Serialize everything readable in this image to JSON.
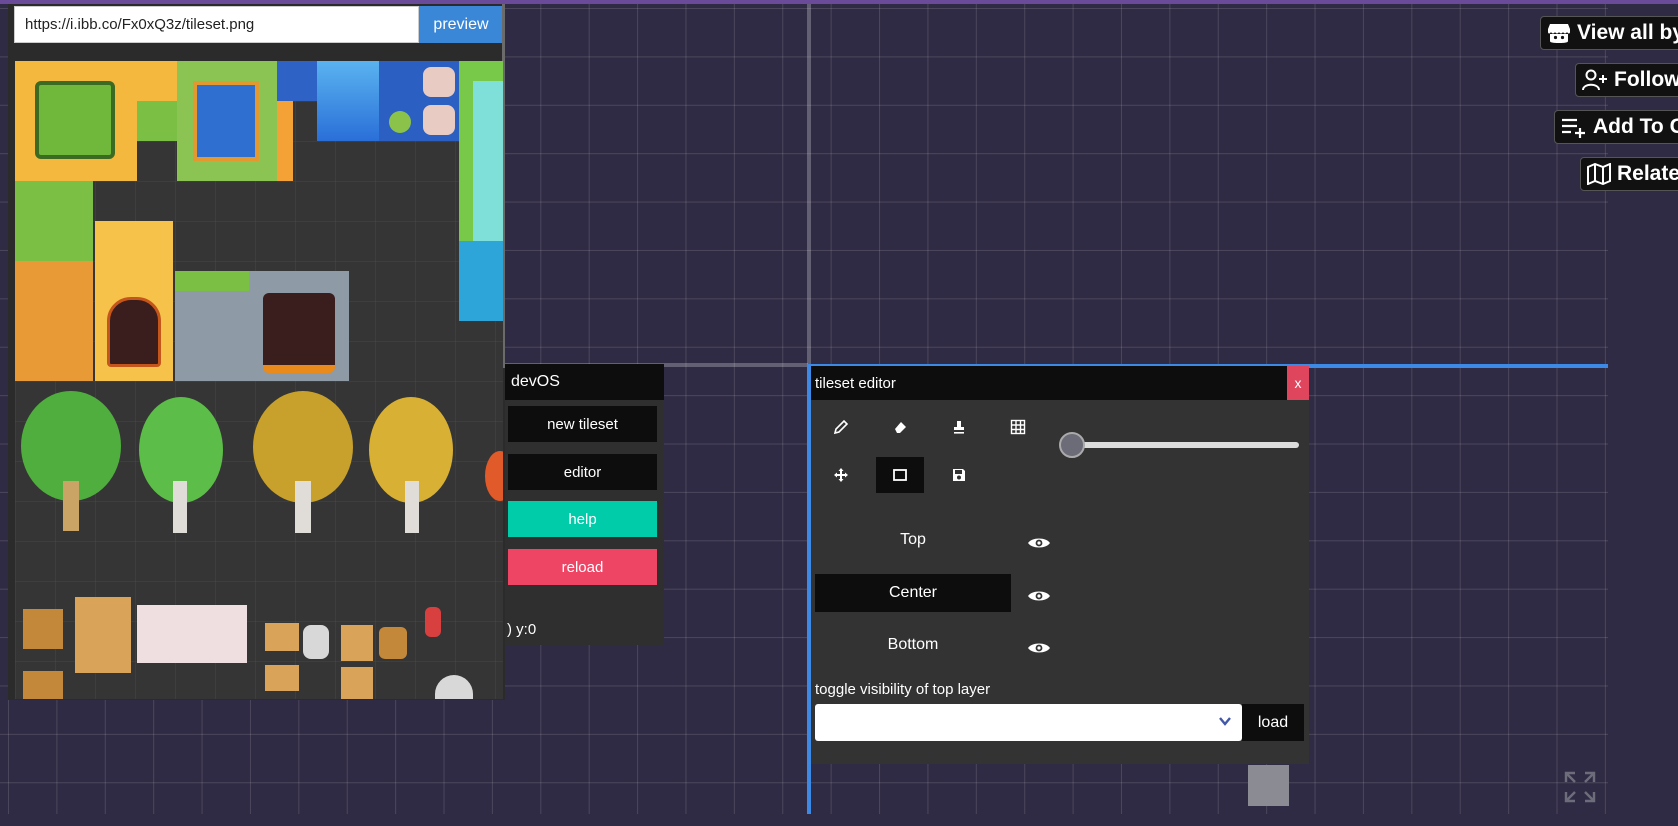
{
  "tileset": {
    "url_value": "https://i.ibb.co/Fx0xQ3z/tileset.png",
    "preview_label": "preview"
  },
  "devos": {
    "title": "devOS",
    "buttons": [
      {
        "label": "new tileset",
        "color": "#0d0d0d"
      },
      {
        "label": "editor",
        "color": "#0d0d0d"
      },
      {
        "label": "help",
        "color": "#00cca9"
      },
      {
        "label": "reload",
        "color": "#ee4565"
      }
    ],
    "coords": ") y:0"
  },
  "editor": {
    "title": "tileset editor",
    "close_label": "x",
    "tools": [
      "pencil-icon",
      "eraser-icon",
      "stamp-icon",
      "grid-icon",
      "move-icon",
      "rectangle-icon",
      "save-icon"
    ],
    "active_tool": "rectangle-icon",
    "slider_value": 0,
    "layers": [
      {
        "label": "Top",
        "active": false
      },
      {
        "label": "Center",
        "active": true
      },
      {
        "label": "Bottom",
        "active": false
      }
    ],
    "toggle_label": "toggle visibility of top layer",
    "select_value": "",
    "load_label": "load"
  },
  "side_buttons": [
    {
      "label": "View all by",
      "icon": "itch-icon"
    },
    {
      "label": "Follow",
      "icon": "follow-user-icon"
    },
    {
      "label": "Add To Co",
      "icon": "add-collection-icon"
    },
    {
      "label": "Relate",
      "icon": "map-icon"
    }
  ],
  "colors": {
    "background": "#302b44",
    "accent_blue": "#3c8ae6",
    "help": "#00cca9",
    "reload": "#ee4565",
    "close": "#e0455e"
  }
}
